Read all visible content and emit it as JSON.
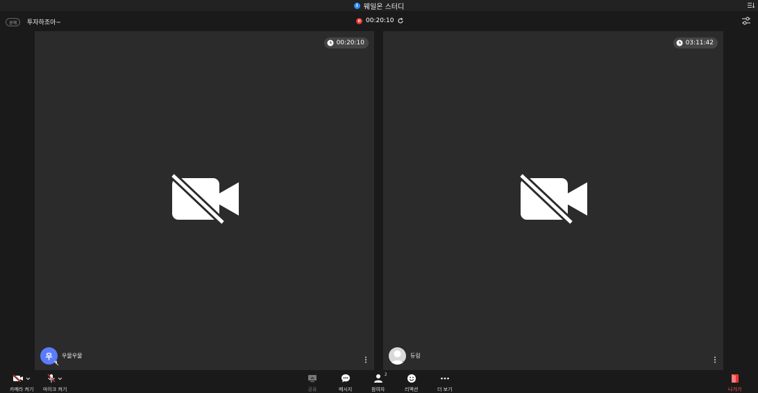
{
  "window": {
    "title": "웨일온 스터디"
  },
  "meeting": {
    "badge": "공개",
    "title": "투자하조아~",
    "recording_time": "00:20:10"
  },
  "participants": [
    {
      "name": "우물우물",
      "avatar_initial": "우",
      "timer": "00:20:10",
      "avatar_color": "#5b7cfa"
    },
    {
      "name": "듀링",
      "avatar_initial": "",
      "timer": "03:11:42",
      "avatar_color": "#d9d9d9"
    }
  ],
  "toolbar": {
    "camera_label": "카메라 켜기",
    "mic_label": "마이크 켜기",
    "share_label": "공유",
    "message_label": "메시지",
    "participants_label": "참여자",
    "participants_count": "2",
    "reaction_label": "리액션",
    "more_label": "더 보기",
    "leave_label": "나가기"
  },
  "icons": [
    "info-icon",
    "expand-icon",
    "record-pause-icon",
    "refresh-icon",
    "settings-sliders-icon",
    "clock-icon",
    "camera-off-icon",
    "mic-off-icon",
    "more-vertical-icon",
    "chevron-down-icon",
    "share-screen-icon",
    "chat-icon",
    "person-icon",
    "smile-icon",
    "more-horizontal-icon",
    "leave-door-icon"
  ],
  "colors": {
    "accent": "#2d8cff",
    "record": "#e53935",
    "leave": "#ff5a5a",
    "tile_bg": "#2b2b2b",
    "app_bg": "#1a1a1a"
  }
}
